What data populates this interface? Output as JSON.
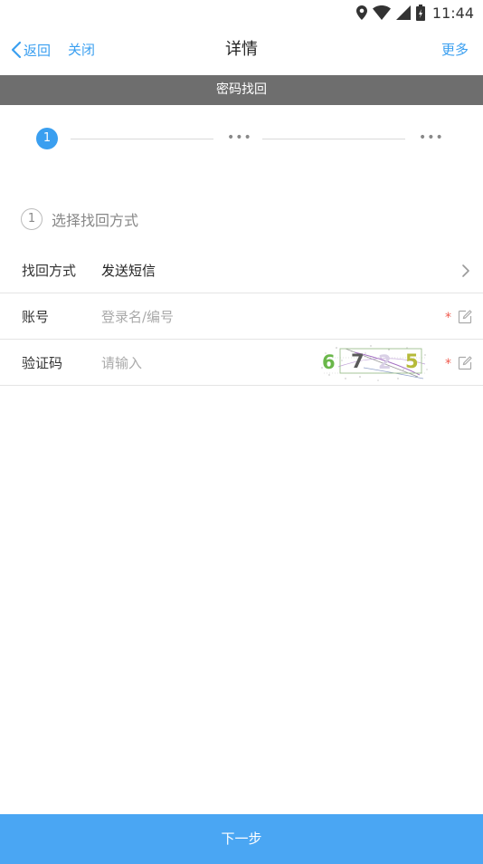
{
  "status_bar": {
    "time": "11:44",
    "icons": [
      "location-icon",
      "wifi-icon",
      "signal-icon",
      "battery-icon"
    ]
  },
  "nav": {
    "back_label": "返回",
    "close_label": "关闭",
    "title": "详情",
    "more_label": "更多"
  },
  "section_title": "密码找回",
  "steps": {
    "current": "1",
    "pending_1": "•••",
    "pending_2": "•••"
  },
  "subheading": {
    "number": "1",
    "text": "选择找回方式"
  },
  "form": {
    "method": {
      "label": "找回方式",
      "value": "发送短信"
    },
    "account": {
      "label": "账号",
      "placeholder": "登录名/编号",
      "required_mark": "*"
    },
    "captcha": {
      "label": "验证码",
      "placeholder": "请输入",
      "required_mark": "*",
      "captcha_text": "6725"
    }
  },
  "next_button": "下一步",
  "colors": {
    "accent": "#3a9ff0",
    "section_bar": "#6e6e6e",
    "button_bg": "#4aa6f3",
    "required": "#f05a4e"
  }
}
